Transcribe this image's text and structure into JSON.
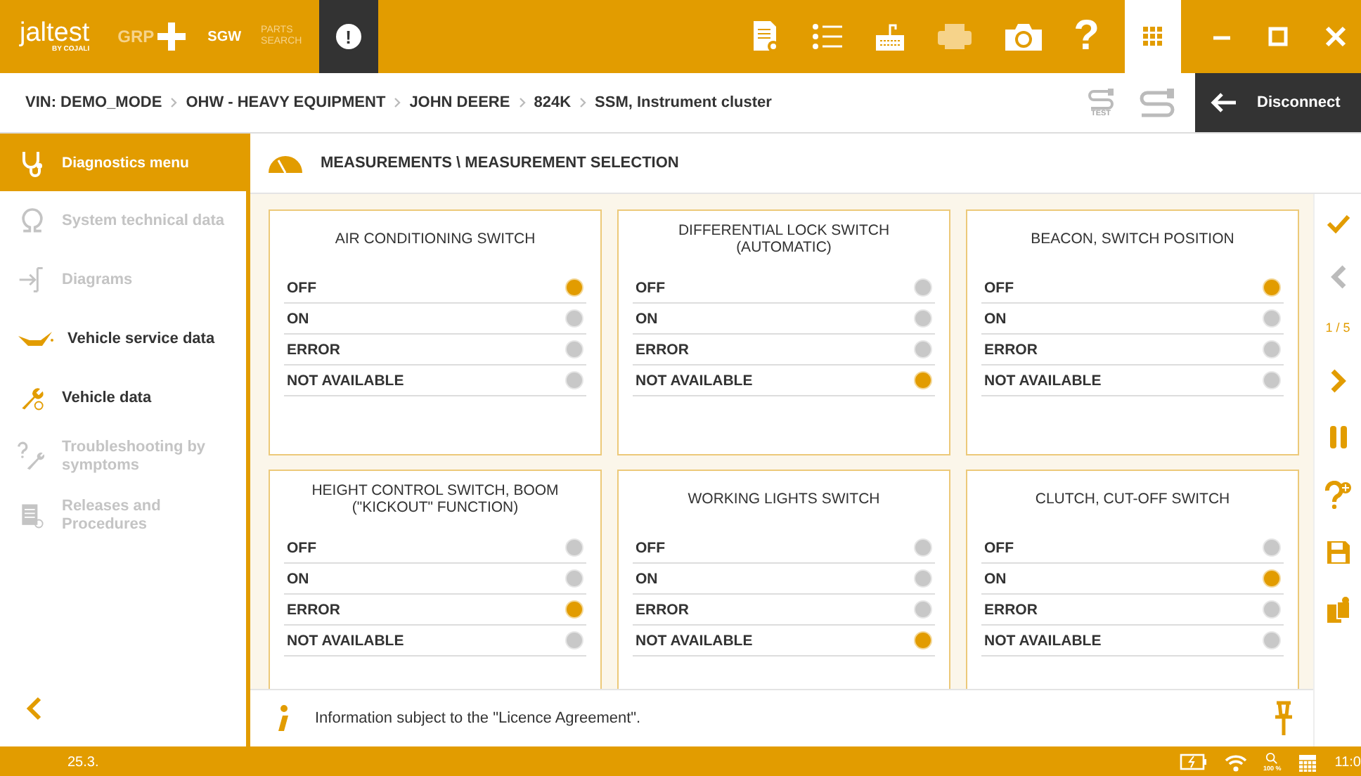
{
  "top_bar": {
    "logo": "jaltest",
    "logo_sub": "BY COJALI",
    "grp": "GRP",
    "sgw": "SGW",
    "parts_search": [
      "PARTS",
      "SEARCH"
    ],
    "alert": "!",
    "help": "?"
  },
  "breadcrumb": [
    "VIN: DEMO_MODE",
    "OHW - HEAVY EQUIPMENT",
    "JOHN DEERE",
    "824K",
    "SSM, Instrument cluster"
  ],
  "test_label": "TEST",
  "disconnect": "Disconnect",
  "sidebar": {
    "header": "Diagnostics menu",
    "items": [
      {
        "label": "System technical data",
        "disabled": true
      },
      {
        "label": "Diagrams",
        "disabled": true
      },
      {
        "label": "Vehicle service data",
        "disabled": false
      },
      {
        "label": "Vehicle data",
        "disabled": false
      },
      {
        "label": "Troubleshooting by symptoms",
        "disabled": true
      },
      {
        "label": "Releases and Procedures",
        "disabled": true
      }
    ]
  },
  "panel_title": "MEASUREMENTS \\ MEASUREMENT SELECTION",
  "cards": [
    {
      "title": "AIR CONDITIONING SWITCH",
      "options": [
        {
          "label": "OFF",
          "selected": true
        },
        {
          "label": "ON",
          "selected": false
        },
        {
          "label": "ERROR",
          "selected": false
        },
        {
          "label": "NOT AVAILABLE",
          "selected": false
        }
      ]
    },
    {
      "title": "DIFFERENTIAL LOCK SWITCH (AUTOMATIC)",
      "options": [
        {
          "label": "OFF",
          "selected": false
        },
        {
          "label": "ON",
          "selected": false
        },
        {
          "label": "ERROR",
          "selected": false
        },
        {
          "label": "NOT AVAILABLE",
          "selected": true
        }
      ]
    },
    {
      "title": "BEACON, SWITCH POSITION",
      "options": [
        {
          "label": "OFF",
          "selected": true
        },
        {
          "label": "ON",
          "selected": false
        },
        {
          "label": "ERROR",
          "selected": false
        },
        {
          "label": "NOT AVAILABLE",
          "selected": false
        }
      ]
    },
    {
      "title": "HEIGHT CONTROL SWITCH, BOOM (\"KICKOUT\" FUNCTION)",
      "options": [
        {
          "label": "OFF",
          "selected": false
        },
        {
          "label": "ON",
          "selected": false
        },
        {
          "label": "ERROR",
          "selected": true
        },
        {
          "label": "NOT AVAILABLE",
          "selected": false
        }
      ]
    },
    {
      "title": "WORKING LIGHTS SWITCH",
      "options": [
        {
          "label": "OFF",
          "selected": false
        },
        {
          "label": "ON",
          "selected": false
        },
        {
          "label": "ERROR",
          "selected": false
        },
        {
          "label": "NOT AVAILABLE",
          "selected": true
        }
      ]
    },
    {
      "title": "CLUTCH, CUT-OFF SWITCH",
      "options": [
        {
          "label": "OFF",
          "selected": false
        },
        {
          "label": "ON",
          "selected": true
        },
        {
          "label": "ERROR",
          "selected": false
        },
        {
          "label": "NOT AVAILABLE",
          "selected": false
        }
      ]
    }
  ],
  "info": "Information subject to the \"Licence Agreement\".",
  "page_indicator": "1 / 5",
  "status_bar": {
    "version": "25.3.",
    "zoom": "100 %",
    "time": "11:0"
  }
}
